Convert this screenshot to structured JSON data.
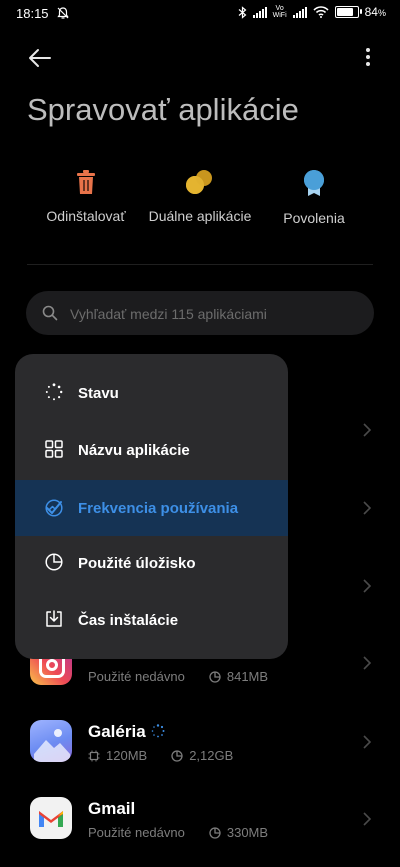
{
  "status": {
    "time": "18:15",
    "battery": "84",
    "battery_unit": "%",
    "vowifi_top": "Vo",
    "vowifi_bottom": "WiFi"
  },
  "header": {
    "title": "Spravovať aplikácie"
  },
  "actions": [
    {
      "label": "Odinštalovať",
      "icon": "trash-icon",
      "color": "#e8734a"
    },
    {
      "label": "Duálne aplikácie",
      "icon": "dual-apps-icon",
      "color": "#e3b431"
    },
    {
      "label": "Povolenia",
      "icon": "permissions-icon",
      "color": "#4a9fd8"
    }
  ],
  "search": {
    "placeholder": "Vyhľadať medzi 115 aplikáciami"
  },
  "sort_menu": {
    "items": [
      {
        "label": "Stavu",
        "icon": "status-dots-icon"
      },
      {
        "label": "Názvu aplikácie",
        "icon": "grid-icon"
      },
      {
        "label": "Frekvencia používania",
        "icon": "frequency-icon",
        "selected": true
      },
      {
        "label": "Použité úložisko",
        "icon": "pie-chart-icon"
      },
      {
        "label": "Čas inštalácie",
        "icon": "download-icon"
      }
    ]
  },
  "apps": [
    {
      "name": "",
      "meta1": "Použité nedávno",
      "meta2": "841MB",
      "icon": "instagram-icon"
    },
    {
      "name": "Galéria",
      "meta1": "120MB",
      "meta2": "2,12GB",
      "icon": "gallery-icon"
    },
    {
      "name": "Gmail",
      "meta1": "Použité nedávno",
      "meta2": "330MB",
      "icon": "gmail-icon"
    }
  ],
  "colors": {
    "accent": "#3d8fe6",
    "menu_bg": "#2b2b2d",
    "selected_bg": "#153354"
  }
}
